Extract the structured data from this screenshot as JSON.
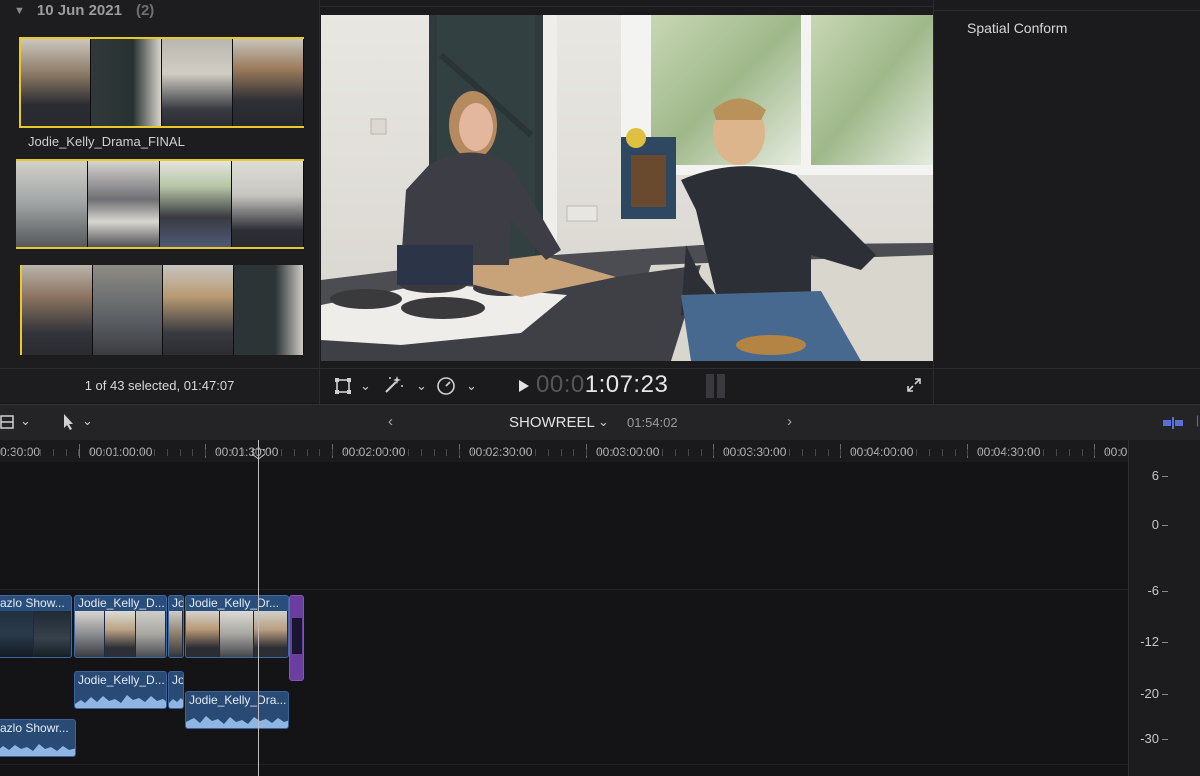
{
  "browser": {
    "date_label": "10 Jun 2021",
    "date_count": "(2)",
    "clips": [
      {
        "name": "Jodie_Kelly_Drama_FINAL"
      }
    ],
    "selection_status": "1 of 43 selected, 01:47:07"
  },
  "viewer": {
    "timecode_dim": "00:0",
    "timecode_bright": "1:07:23"
  },
  "inspector": {
    "label": "Spatial Conform"
  },
  "timeline": {
    "project_name": "SHOWREEL",
    "project_duration": "01:54:02",
    "ruler_labels": [
      "0:30:00",
      "00:01:00:00",
      "00:01:30:00",
      "00:02:00:00",
      "00:02:30:00",
      "00:03:00:00",
      "00:03:30:00",
      "00:04:00:00",
      "00:04:30:00",
      "00:0"
    ],
    "video_clips": [
      {
        "title": "azlo Show..."
      },
      {
        "title": "Jodie_Kelly_D..."
      },
      {
        "title": "Jo"
      },
      {
        "title": "Jodie_Kelly_Dr..."
      }
    ],
    "audio_clips": [
      {
        "title": "Jodie_Kelly_D..."
      },
      {
        "title": "Jo"
      },
      {
        "title": "Jodie_Kelly_Dra..."
      },
      {
        "title": "azlo Showr..."
      }
    ]
  },
  "meter": {
    "labels": [
      "6",
      "0",
      "-6",
      "-12",
      "-20",
      "-30"
    ]
  },
  "colors": {
    "selection": "#e8c92a",
    "clip_blue": "#2a4e7c",
    "compound_purple": "#6b3fa0"
  }
}
